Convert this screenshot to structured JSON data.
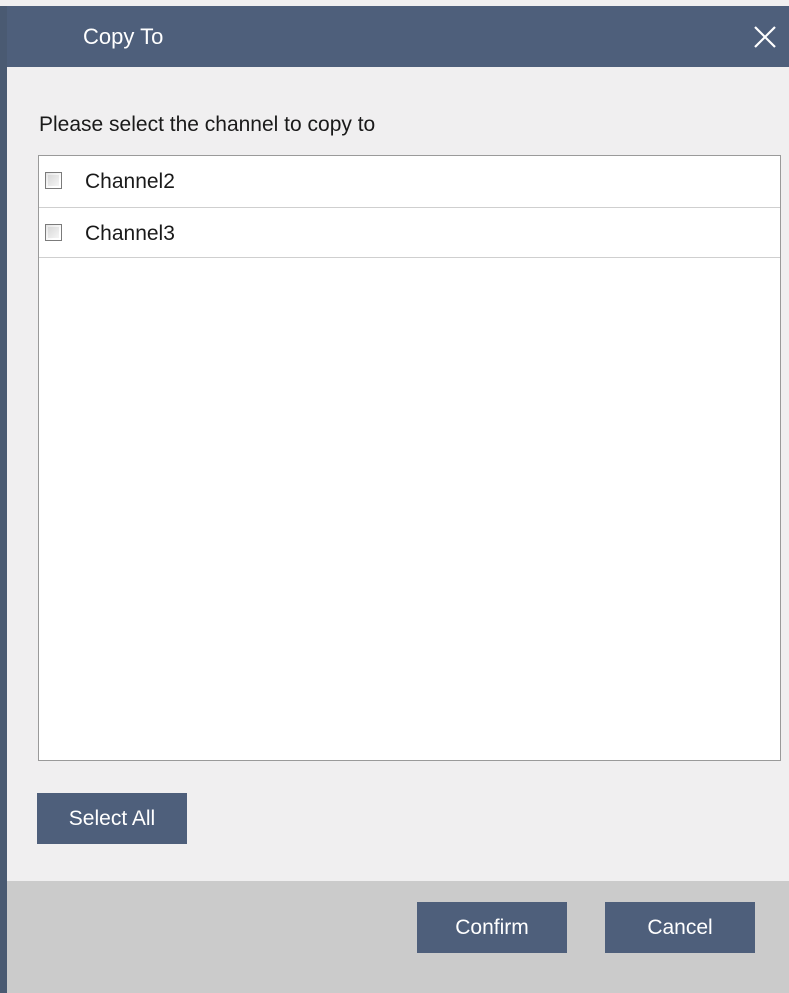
{
  "dialog": {
    "title": "Copy To",
    "close_icon": "close-icon"
  },
  "prompt": "Please select the channel to copy to",
  "channels": [
    {
      "label": "Channel2",
      "checked": false
    },
    {
      "label": "Channel3",
      "checked": false
    }
  ],
  "buttons": {
    "select_all": "Select All",
    "confirm": "Confirm",
    "cancel": "Cancel"
  },
  "colors": {
    "titlebar": "#4e5f7b",
    "button": "#4e5f7b",
    "footer": "#cbcbcb",
    "body": "#f0eff0"
  }
}
